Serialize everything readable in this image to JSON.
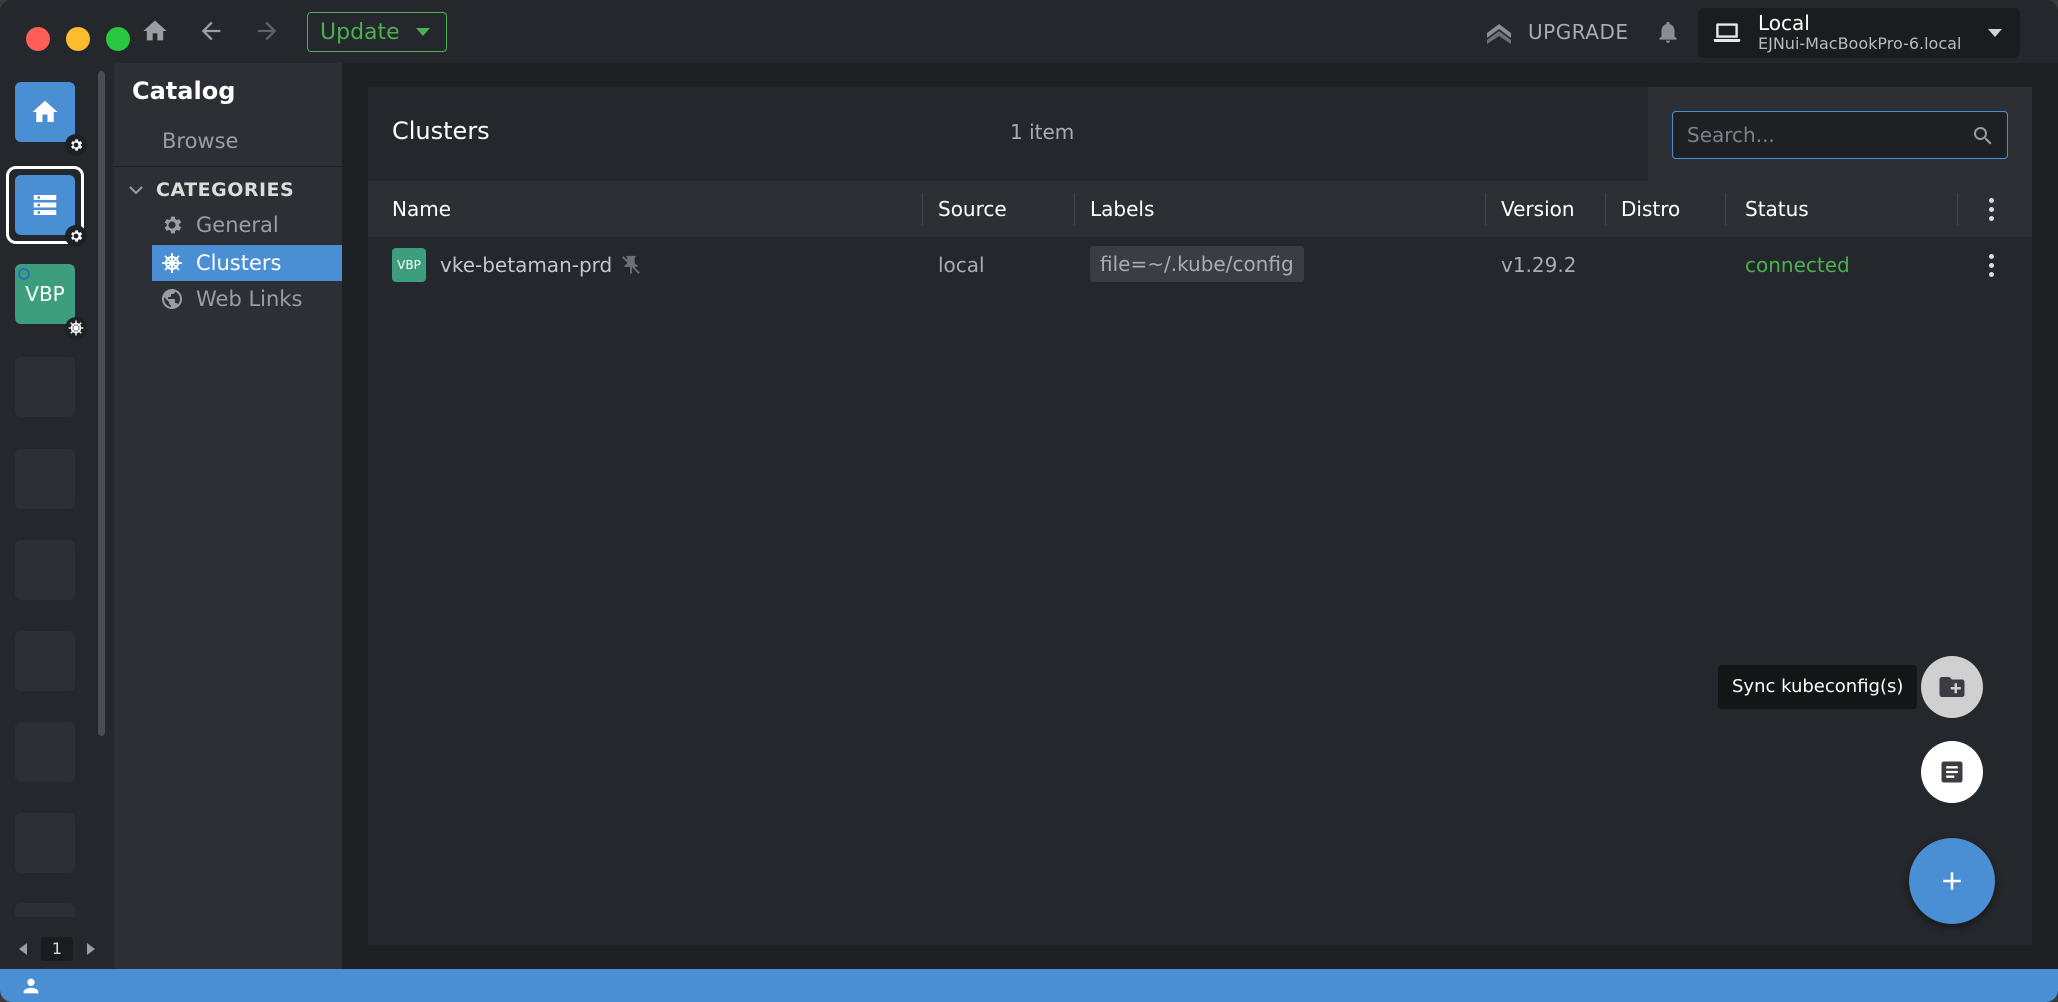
{
  "titlebar": {
    "update_label": "Update",
    "upgrade_label": "UPGRADE",
    "host": {
      "name": "Local",
      "subtitle": "EJNui-MacBookPro-6.local"
    }
  },
  "hotbar": {
    "vbp_label": "VBP",
    "page_number": "1"
  },
  "sidebar": {
    "title": "Catalog",
    "browse_label": "Browse",
    "categories_label": "CATEGORIES",
    "items": [
      {
        "label": "General",
        "icon": "gear-icon",
        "active": false
      },
      {
        "label": "Clusters",
        "icon": "helm-wheel-icon",
        "active": true
      },
      {
        "label": "Web Links",
        "icon": "globe-icon",
        "active": false
      }
    ]
  },
  "main": {
    "title": "Clusters",
    "item_count": "1 item",
    "search": {
      "placeholder": "Search..."
    },
    "columns": [
      "Name",
      "Source",
      "Labels",
      "Version",
      "Distro",
      "Status"
    ],
    "rows": [
      {
        "avatar": "VBP",
        "name": "vke-betaman-prd",
        "source": "local",
        "label": "file=~/.kube/config",
        "version": "v1.29.2",
        "distro": "",
        "status": "connected"
      }
    ]
  },
  "fabs": {
    "sync_tooltip": "Sync kubeconfig(s)"
  },
  "colors": {
    "accent": "#4a8ed4",
    "status_ok": "#4caf50",
    "cluster_avatar": "#3d9e7d"
  }
}
